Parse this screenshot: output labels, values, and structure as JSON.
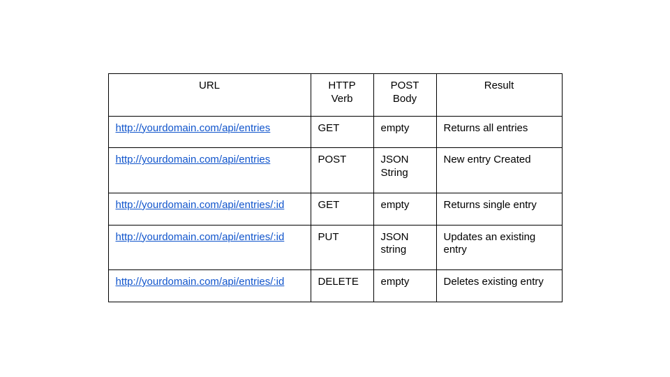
{
  "chart_data": {
    "type": "table",
    "headers": [
      "URL",
      "HTTP Verb",
      "POST Body",
      "Result"
    ],
    "rows": [
      [
        "http://yourdomain.com/api/entries",
        "GET",
        "empty",
        "Returns all entries"
      ],
      [
        "http://yourdomain.com/api/entries",
        "POST",
        "JSON String",
        "New entry Created"
      ],
      [
        "http://yourdomain.com/api/entries/:id",
        "GET",
        "empty",
        "Returns single entry"
      ],
      [
        "http://yourdomain.com/api/entries/:id",
        "PUT",
        "JSON string",
        "Updates an existing entry"
      ],
      [
        "http://yourdomain.com/api/entries/:id",
        "DELETE",
        "empty",
        "Deletes existing entry"
      ]
    ]
  },
  "headers": {
    "url": "URL",
    "verb": "HTTP Verb",
    "body": "POST Body",
    "result": "Result"
  },
  "rows": [
    {
      "url": "http://yourdomain.com/api/entries",
      "verb": "GET",
      "body": "empty",
      "result": "Returns all entries"
    },
    {
      "url": "http://yourdomain.com/api/entries",
      "verb": "POST",
      "body": "JSON String",
      "result": "New entry Created"
    },
    {
      "url": "http://yourdomain.com/api/entries/:id",
      "verb": "GET",
      "body": "empty",
      "result": "Returns single entry"
    },
    {
      "url": "http://yourdomain.com/api/entries/:id",
      "verb": "PUT",
      "body": "JSON string",
      "result": "Updates an existing entry"
    },
    {
      "url": "http://yourdomain.com/api/entries/:id",
      "verb": "DELETE",
      "body": "empty",
      "result": "Deletes existing entry"
    }
  ]
}
